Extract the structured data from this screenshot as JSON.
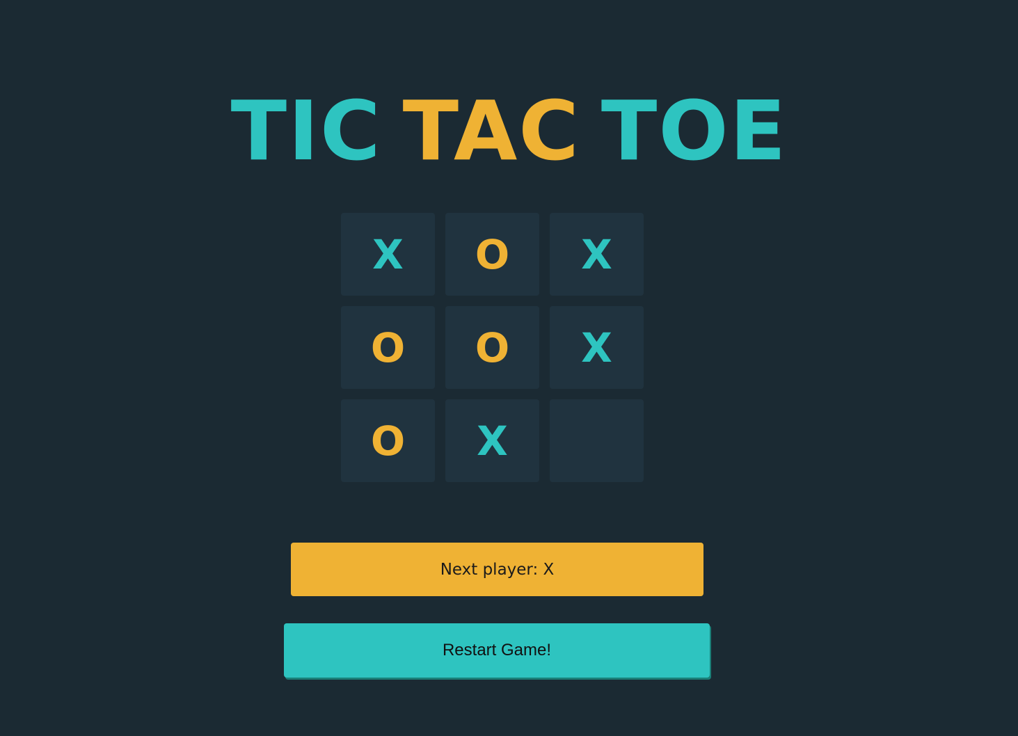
{
  "title": {
    "words": [
      "TIC",
      "TAC",
      "TOE"
    ],
    "colors": [
      "#2ec4c0",
      "#efb234",
      "#2ec4c0"
    ]
  },
  "board": {
    "cells": [
      "X",
      "O",
      "X",
      "O",
      "O",
      "X",
      "O",
      "X",
      ""
    ]
  },
  "colors": {
    "background": "#1b2a33",
    "cell": "#20333f",
    "x_mark": "#2ec4c0",
    "o_mark": "#efb234",
    "status_bg": "#efb234",
    "restart_bg": "#2ec4c0"
  },
  "status": {
    "label": "Next player: X"
  },
  "restart": {
    "label": "Restart Game!"
  }
}
